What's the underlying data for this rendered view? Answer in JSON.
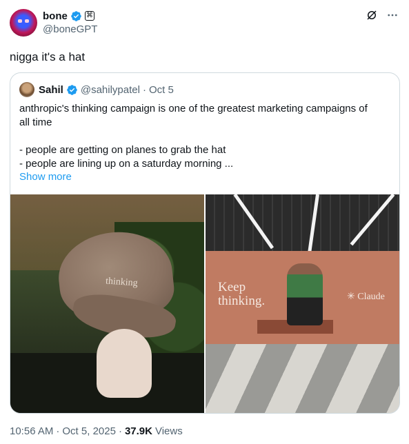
{
  "author": {
    "display_name": "bone",
    "handle": "@boneGPT",
    "affiliate_badge": "⌘",
    "icons": {
      "verified": "verified-badge-icon",
      "grok": "grok-icon",
      "more": "more-icon"
    }
  },
  "tweet": {
    "text": "nigga it's a hat"
  },
  "quote": {
    "display_name": "Sahil",
    "handle": "@sahilypatel",
    "separator": "·",
    "date": "Oct 5",
    "lines": [
      "anthropic's thinking campaign is one of the greatest marketing campaigns of",
      "all time",
      "",
      "- people are getting on planes to grab the hat",
      "- people are lining up on a saturday morning ..."
    ],
    "show_more": "Show more",
    "media": {
      "image1": {
        "cap_text": "thinking"
      },
      "image2": {
        "headline_line1": "Keep",
        "headline_line2": "thinking.",
        "brand": "Claude"
      }
    }
  },
  "meta": {
    "time": "10:56 AM",
    "date": "Oct 5, 2025",
    "views_count": "37.9K",
    "views_label": "Views",
    "separator": "·"
  },
  "colors": {
    "accent": "#1d9bf0",
    "text": "#0f1419",
    "secondary": "#536471",
    "border": "#cfd9de"
  }
}
